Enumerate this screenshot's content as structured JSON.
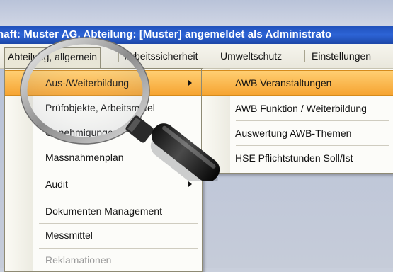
{
  "window": {
    "title": "haft: Muster AG,  Abteilung: [Muster] angemeldet als Administrato"
  },
  "menubar": {
    "items": [
      {
        "label": "Abteilung, allgemein"
      },
      {
        "label": "Arbeitssicherheit"
      },
      {
        "label": "Umweltschutz"
      },
      {
        "label": "Einstellungen"
      }
    ]
  },
  "menu": {
    "items": [
      {
        "label": "Aus-/Weiterbildung"
      },
      {
        "label": "Prüfobjekte, Arbeitsmittel"
      },
      {
        "label": "Genehmigungen"
      },
      {
        "label": "Massnahmenplan"
      },
      {
        "label": "Audit"
      },
      {
        "label": "Dokumenten Management"
      },
      {
        "label": "Messmittel"
      },
      {
        "label": "Reklamationen"
      }
    ]
  },
  "submenu": {
    "items": [
      {
        "label": "AWB Veranstaltungen"
      },
      {
        "label": "AWB Funktion / Weiterbildung"
      },
      {
        "label": "Auswertung AWB-Themen"
      },
      {
        "label": "HSE Pflichtstunden Soll/Ist"
      }
    ]
  },
  "colors": {
    "titlebar": "#2d64d6",
    "highlight": "#f6a431",
    "menu_bg": "#fcfcf9"
  },
  "icons": {
    "magnifier": "magnifying-glass-icon"
  }
}
